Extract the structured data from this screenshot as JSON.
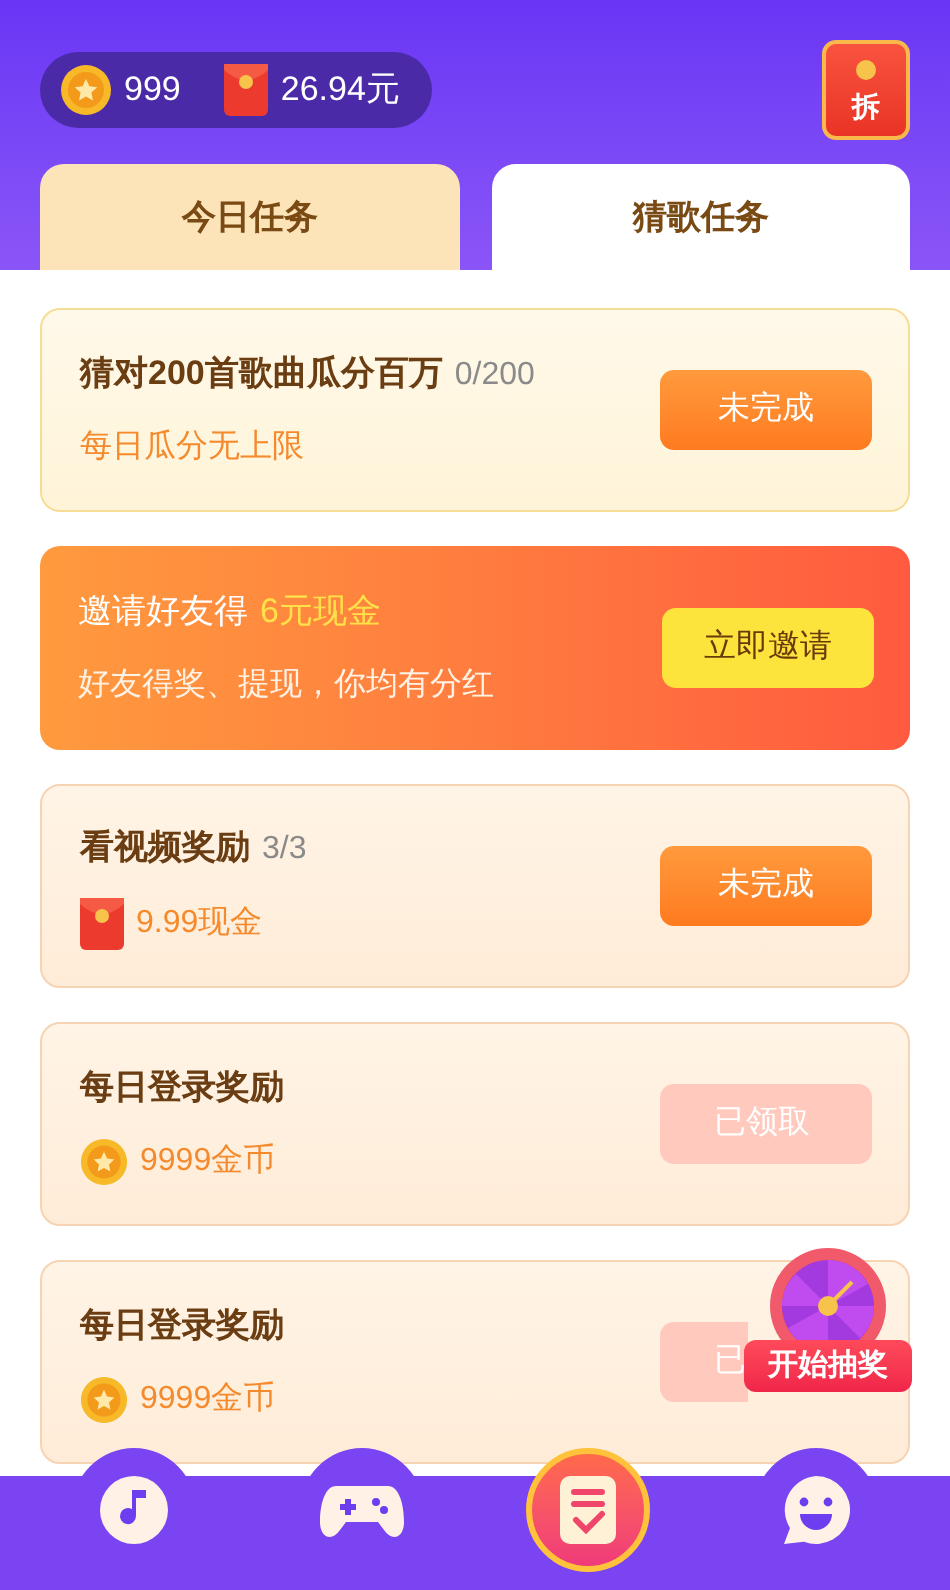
{
  "header": {
    "coins": "999",
    "cash": "26.94元",
    "red_packet_label": "拆"
  },
  "tabs": [
    {
      "label": "今日任务",
      "selected": false
    },
    {
      "label": "猜歌任务",
      "selected": true
    }
  ],
  "tasks": [
    {
      "kind": "progress",
      "title": "猜对200首歌曲瓜分百万",
      "progress": "0/200",
      "subtitle": "每日瓜分无上限",
      "button": {
        "label": "未完成",
        "kind": "pending"
      }
    },
    {
      "kind": "invite",
      "title": "邀请好友得",
      "highlight": "6元现金",
      "subtitle": "好友得奖、提现，你均有分红",
      "button": {
        "label": "立即邀请",
        "kind": "invite"
      }
    },
    {
      "kind": "reward",
      "title": "看视频奖励",
      "progress": "3/3",
      "reward": {
        "kind": "packet"
      },
      "subtitle": "9.99现金",
      "button": {
        "label": "未完成",
        "kind": "pending"
      }
    },
    {
      "kind": "reward",
      "title": "每日登录奖励",
      "reward": {
        "kind": "coin"
      },
      "subtitle": "9999金币",
      "button": {
        "label": "已领取",
        "kind": "claimed"
      }
    },
    {
      "kind": "reward",
      "title": "每日登录奖励",
      "reward": {
        "kind": "coin"
      },
      "subtitle": "9999金币",
      "button": {
        "label": "已",
        "kind": "claimed",
        "clipped": true
      }
    }
  ],
  "lottery": {
    "label": "开始抽奖"
  },
  "nav": [
    {
      "selected": false
    },
    {
      "selected": false
    },
    {
      "selected": true
    },
    {
      "selected": false
    }
  ]
}
